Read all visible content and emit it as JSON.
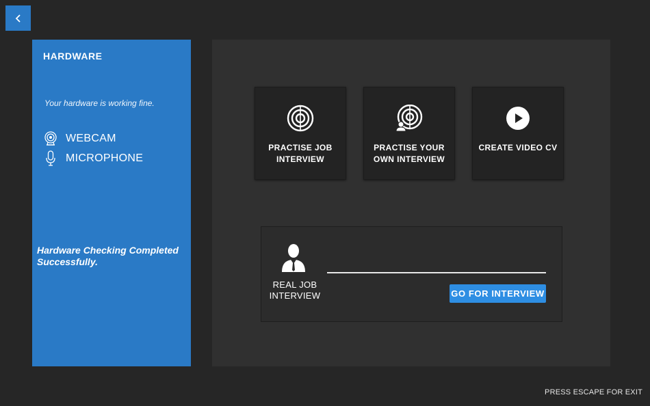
{
  "back_button": {
    "icon": "chevron-left-icon"
  },
  "sidebar": {
    "title": "HARDWARE",
    "status": "Your hardware is working fine.",
    "items": [
      {
        "icon": "webcam-icon",
        "label": "WEBCAM"
      },
      {
        "icon": "microphone-icon",
        "label": "MICROPHONE"
      }
    ],
    "completion": "Hardware Checking Completed Successfully."
  },
  "cards": [
    {
      "icon": "target-icon",
      "label": "PRACTISE JOB INTERVIEW"
    },
    {
      "icon": "target-user-icon",
      "label": "PRACTISE YOUR OWN INTERVIEW"
    },
    {
      "icon": "play-icon",
      "label": "CREATE VIDEO CV"
    }
  ],
  "real_interview": {
    "icon": "businessman-icon",
    "label": "REAL JOB INTERVIEW",
    "input_value": "",
    "button_label": "GO FOR INTERVIEW"
  },
  "footer": {
    "escape_hint": "PRESS ESCAPE FOR EXIT"
  },
  "colors": {
    "background": "#262626",
    "panel": "#303030",
    "sidebar": "#2a7ac6",
    "card": "#232323",
    "button": "#2e8ee3"
  }
}
